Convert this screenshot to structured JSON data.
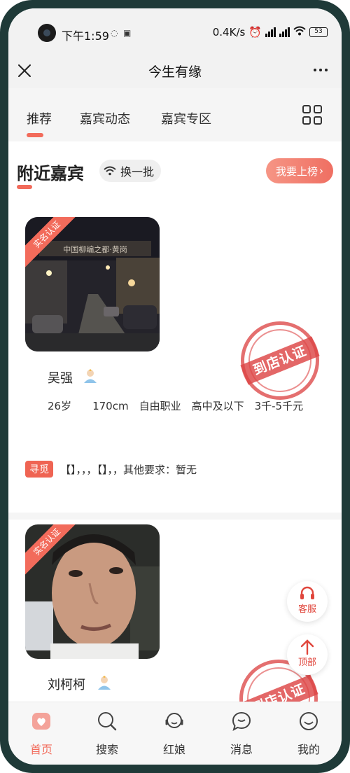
{
  "status_bar": {
    "time": "下午1:59",
    "network_speed": "0.4K/s",
    "battery": "53"
  },
  "title_bar": {
    "title": "今生有缘"
  },
  "tabs": [
    {
      "label": "推荐",
      "active": true
    },
    {
      "label": "嘉宾动态",
      "active": false
    },
    {
      "label": "嘉宾专区",
      "active": false
    }
  ],
  "section": {
    "title": "附近嘉宾",
    "refresh_label": "换一批",
    "rank_label": "我要上榜"
  },
  "profiles": [
    {
      "badge": "实名认证",
      "photo_sign_text": "中国柳编之都·黄岗",
      "name": "吴强",
      "details": "26岁　　170cm　自由职业　高中及以下　3千-5千元",
      "seek_tag": "寻觅",
      "seek_text": "【】，，，【】，，其他要求：暂无",
      "stamp": "到店认证"
    },
    {
      "badge": "实名认证",
      "name": "刘柯柯",
      "stamp": "到店认证"
    }
  ],
  "floating_buttons": {
    "service_label": "客服",
    "top_label": "顶部"
  },
  "bottom_nav": [
    {
      "label": "首页",
      "icon": "home-icon",
      "active": true
    },
    {
      "label": "搜索",
      "icon": "search-icon",
      "active": false
    },
    {
      "label": "红娘",
      "icon": "matchmaker-icon",
      "active": false
    },
    {
      "label": "消息",
      "icon": "message-icon",
      "active": false
    },
    {
      "label": "我的",
      "icon": "profile-icon",
      "active": false
    }
  ],
  "colors": {
    "accent": "#f26b5b",
    "stamp": "#dd4646"
  }
}
